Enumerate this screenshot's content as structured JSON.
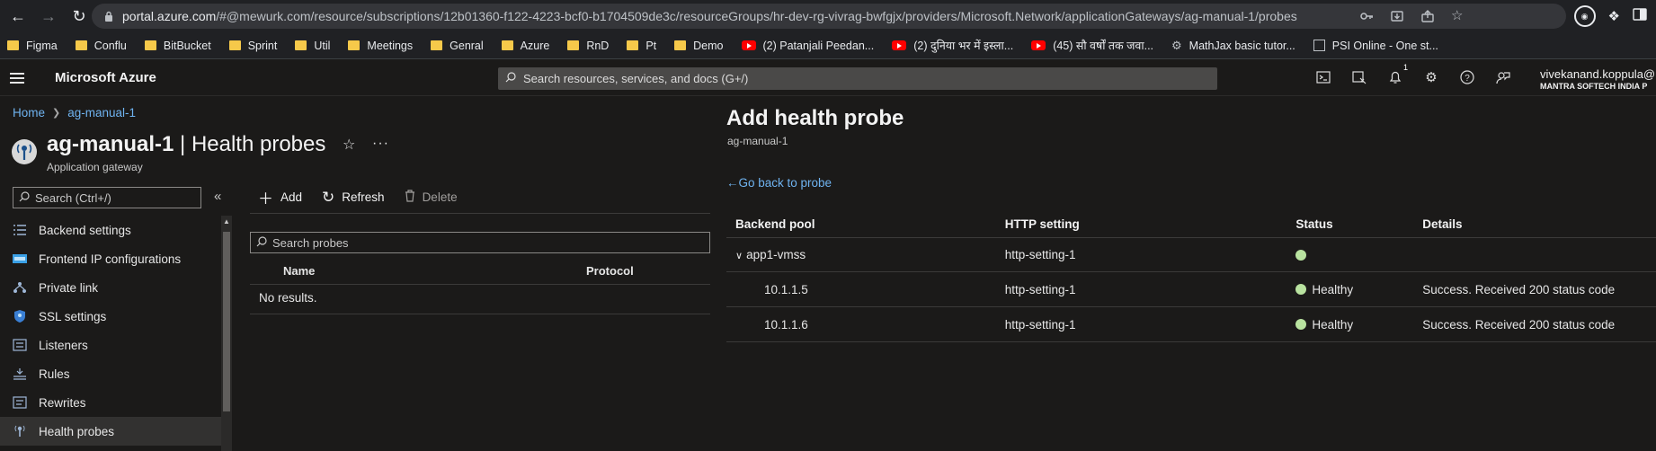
{
  "browser": {
    "url_host": "portal.azure.com",
    "url_path": "/#@mewurk.com/resource/subscriptions/12b01360-f122-4223-bcf0-b1704509de3c/resourceGroups/hr-dev-rg-vivrag-bwfgjx/providers/Microsoft.Network/applicationGateways/ag-manual-1/probes",
    "bookmarks": [
      {
        "label": "Figma",
        "icon": "folder-icon"
      },
      {
        "label": "Conflu",
        "icon": "folder-icon"
      },
      {
        "label": "BitBucket",
        "icon": "folder-icon"
      },
      {
        "label": "Sprint",
        "icon": "folder-icon"
      },
      {
        "label": "Util",
        "icon": "folder-icon"
      },
      {
        "label": "Meetings",
        "icon": "folder-icon"
      },
      {
        "label": "Genral",
        "icon": "folder-icon"
      },
      {
        "label": "Azure",
        "icon": "folder-icon"
      },
      {
        "label": "RnD",
        "icon": "folder-icon"
      },
      {
        "label": "Pt",
        "icon": "folder-icon"
      },
      {
        "label": "Demo",
        "icon": "folder-icon"
      },
      {
        "label": "(2) Patanjali Peedan...",
        "icon": "youtube-icon"
      },
      {
        "label": "(2) दुनिया भर में इस्ला...",
        "icon": "youtube-icon"
      },
      {
        "label": "(45) सौ वर्षों तक जवा...",
        "icon": "youtube-icon"
      },
      {
        "label": "MathJax basic tutor...",
        "icon": "gear-icon"
      },
      {
        "label": "PSI Online - One st...",
        "icon": "page-icon"
      }
    ]
  },
  "azure": {
    "brand": "Microsoft Azure",
    "search_placeholder": "Search resources, services, and docs (G+/)",
    "notification_count": "1",
    "user_name": "vivekanand.koppula@",
    "user_org": "MANTRA SOFTECH INDIA P"
  },
  "breadcrumb": {
    "home": "Home",
    "current": "ag-manual-1"
  },
  "resource": {
    "name": "ag-manual-1",
    "section": " | Health probes",
    "type": "Application gateway"
  },
  "left_search_placeholder": "Search (Ctrl+/)",
  "menu": [
    {
      "label": "Backend settings",
      "icon": "list-icon"
    },
    {
      "label": "Frontend IP configurations",
      "icon": "ip-icon"
    },
    {
      "label": "Private link",
      "icon": "link-icon"
    },
    {
      "label": "SSL settings",
      "icon": "shield-icon"
    },
    {
      "label": "Listeners",
      "icon": "listener-icon"
    },
    {
      "label": "Rules",
      "icon": "rules-icon"
    },
    {
      "label": "Rewrites",
      "icon": "rewrite-icon"
    },
    {
      "label": "Health probes",
      "icon": "probe-icon",
      "active": true
    }
  ],
  "toolbar": {
    "add": "Add",
    "refresh": "Refresh",
    "delete": "Delete"
  },
  "probes": {
    "search_placeholder": "Search probes",
    "columns": [
      "Name",
      "Protocol"
    ],
    "empty": "No results."
  },
  "blade": {
    "title": "Add health probe",
    "subtitle": "ag-manual-1",
    "go_back": "Go back to probe",
    "columns": {
      "pool": "Backend pool",
      "http": "HTTP setting",
      "status": "Status",
      "details": "Details"
    },
    "group": {
      "pool": "app1-vmss",
      "http": "http-setting-1"
    },
    "rows": [
      {
        "pool": "10.1.1.5",
        "http": "http-setting-1",
        "status": "Healthy",
        "details": "Success. Received 200 status code"
      },
      {
        "pool": "10.1.1.6",
        "http": "http-setting-1",
        "status": "Healthy",
        "details": "Success. Received 200 status code"
      }
    ]
  },
  "colors": {
    "link": "#6fb3f0",
    "healthy": "#b9e3a0",
    "bg": "#1b1a19"
  }
}
